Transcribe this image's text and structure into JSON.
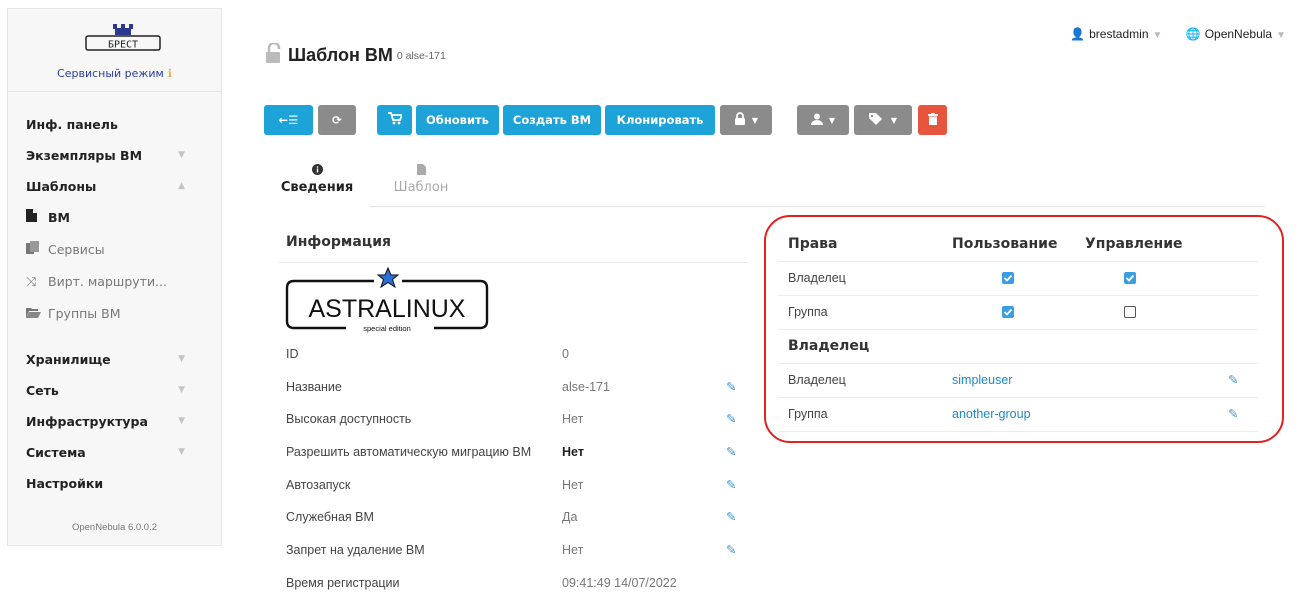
{
  "brand": {
    "logo_text": "БРЕСТ",
    "mode_label": "Сервисный режим",
    "info_glyph": "ℹ"
  },
  "sidebar": {
    "items": [
      {
        "label": "Инф. панель"
      },
      {
        "label": "Экземпляры ВМ"
      },
      {
        "label": "Шаблоны"
      },
      {
        "label": "ВМ"
      },
      {
        "label": "Сервисы"
      },
      {
        "label": "Вирт. маршрути..."
      },
      {
        "label": "Группы ВМ"
      },
      {
        "label": "Хранилище"
      },
      {
        "label": "Сеть"
      },
      {
        "label": "Инфраструктура"
      },
      {
        "label": "Система"
      },
      {
        "label": "Настройки"
      }
    ],
    "version": "OpenNebula 6.0.0.2"
  },
  "header": {
    "title": "Шаблон ВМ",
    "subtitle": "0 alse-171",
    "user": "brestadmin",
    "zone": "OpenNebula"
  },
  "toolbar": {
    "refresh_label": "Обновить",
    "create_vm_label": "Создать ВМ",
    "clone_label": "Клонировать"
  },
  "tabs": [
    {
      "label": "Сведения",
      "active": true
    },
    {
      "label": "Шаблон",
      "active": false
    }
  ],
  "info": {
    "section_title": "Информация",
    "logo_text": "ASTRALINUX",
    "logo_sub": "special edition",
    "rows": [
      {
        "label": "ID",
        "value": "0"
      },
      {
        "label": "Название",
        "value": "alse-171"
      },
      {
        "label": "Высокая доступность",
        "value": "Нет"
      },
      {
        "label": "Разрешить автоматическую миграцию ВМ",
        "value": "Нет"
      },
      {
        "label": "Автозапуск",
        "value": "Нет"
      },
      {
        "label": "Служебная ВМ",
        "value": "Да"
      },
      {
        "label": "Запрет на удаление ВМ",
        "value": "Нет"
      },
      {
        "label": "Время регистрации",
        "value": "09:41:49 14/07/2022"
      }
    ]
  },
  "permissions": {
    "header": {
      "rights": "Права",
      "use": "Пользование",
      "manage": "Управление"
    },
    "rows": [
      {
        "label": "Владелец",
        "use": true,
        "manage": true
      },
      {
        "label": "Группа",
        "use": true,
        "manage": false
      }
    ]
  },
  "ownership": {
    "section_title": "Владелец",
    "rows": [
      {
        "label": "Владелец",
        "value": "simpleuser"
      },
      {
        "label": "Группа",
        "value": "another-group"
      }
    ]
  },
  "colors": {
    "primary": "#1ea3d8",
    "danger": "#e8553f",
    "neutral": "#8b8b8b",
    "highlight": "#e0231f",
    "link": "#1e88c8"
  }
}
